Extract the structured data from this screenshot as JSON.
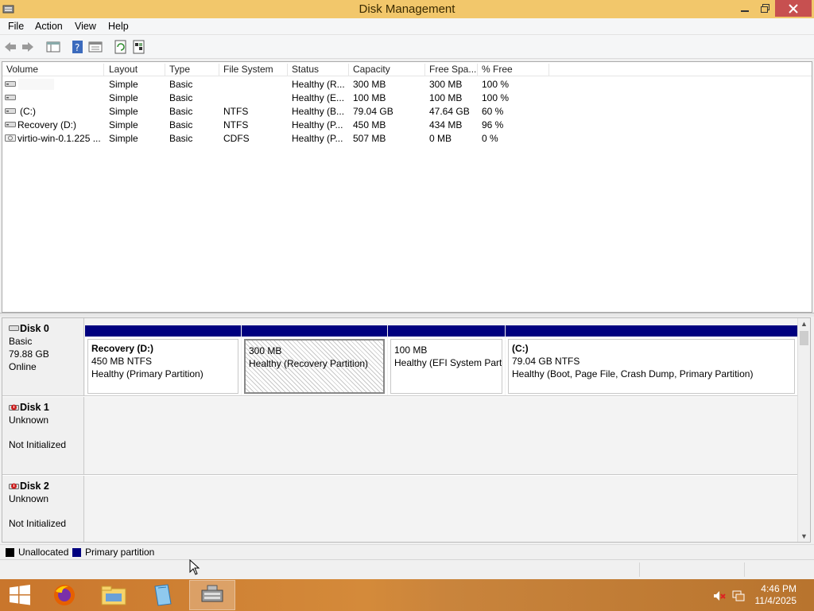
{
  "window": {
    "title": "Disk Management"
  },
  "menu": [
    "File",
    "Action",
    "View",
    "Help"
  ],
  "volume_table": {
    "headers": [
      "Volume",
      "Layout",
      "Type",
      "File System",
      "Status",
      "Capacity",
      "Free Spa...",
      "% Free"
    ],
    "rows": [
      [
        "",
        "Simple",
        "Basic",
        "",
        "Healthy (R...",
        "300 MB",
        "300 MB",
        "100 %"
      ],
      [
        "",
        "Simple",
        "Basic",
        "",
        "Healthy (E...",
        "100 MB",
        "100 MB",
        "100 %"
      ],
      [
        "(C:)",
        "Simple",
        "Basic",
        "NTFS",
        "Healthy (B...",
        "79.04 GB",
        "47.64 GB",
        "60 %"
      ],
      [
        "Recovery (D:)",
        "Simple",
        "Basic",
        "NTFS",
        "Healthy (P...",
        "450 MB",
        "434 MB",
        "96 %"
      ],
      [
        "virtio-win-0.1.225 ...",
        "Simple",
        "Basic",
        "CDFS",
        "Healthy (P...",
        "507 MB",
        "0 MB",
        "0 %"
      ]
    ]
  },
  "disks": [
    {
      "name": "Disk 0",
      "type": "Basic",
      "size": "79.88 GB",
      "state": "Online",
      "partitions": [
        {
          "name": "Recovery  (D:)",
          "size": "450 MB NTFS",
          "status": "Healthy (Primary Partition)"
        },
        {
          "name": "",
          "size": "300 MB",
          "status": "Healthy (Recovery Partition)"
        },
        {
          "name": "",
          "size": "100 MB",
          "status": "Healthy (EFI System Partiti"
        },
        {
          "name": "(C:)",
          "size": "79.04 GB NTFS",
          "status": "Healthy (Boot, Page File, Crash Dump, Primary Partition)"
        }
      ]
    },
    {
      "name": "Disk 1",
      "type": "Unknown",
      "state": "Not Initialized"
    },
    {
      "name": "Disk 2",
      "type": "Unknown",
      "state": "Not Initialized"
    }
  ],
  "legend": [
    {
      "label": "Unallocated",
      "color": "#000000"
    },
    {
      "label": "Primary partition",
      "color": "#00007f"
    }
  ],
  "taskbar": {
    "apps": [
      "start-button",
      "firefox",
      "file-explorer",
      "help-app",
      "disk-management"
    ],
    "time": "4:46 PM",
    "date": "11/4/2025"
  }
}
